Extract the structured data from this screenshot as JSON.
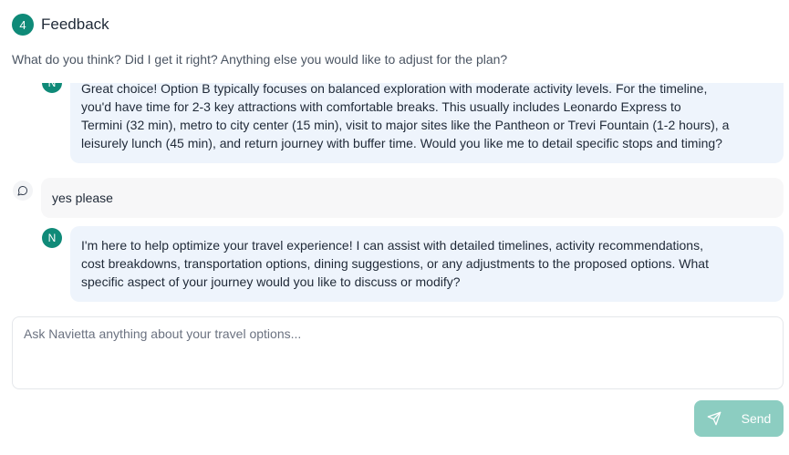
{
  "header": {
    "step_number": "4",
    "title": "Feedback"
  },
  "subtitle": "What do you think? Did I get it right? Anything else you would like to adjust for the plan?",
  "messages": [
    {
      "role": "assistant",
      "avatar": "N",
      "lines": [
        "Great choice! Option B typically focuses on balanced exploration with moderate activity levels. For the timeline,",
        "you'd have time for 2-3 key attractions with comfortable breaks. This usually includes Leonardo Express to",
        "Termini (32 min), metro to city center (15 min), visit to major sites like the Pantheon or Trevi Fountain (1-2 hours), a",
        "leisurely lunch (45 min), and return journey with buffer time. Would you like me to detail specific stops and timing?"
      ]
    },
    {
      "role": "user",
      "icon": "chat-bubble-icon",
      "text": "yes please"
    },
    {
      "role": "assistant",
      "avatar": "N",
      "lines": [
        "I'm here to help optimize your travel experience! I can assist with detailed timelines, activity recommendations,",
        "cost breakdowns, transportation options, dining suggestions, or any adjustments to the proposed options. What",
        "specific aspect of your journey would you like to discuss or modify?"
      ]
    }
  ],
  "composer": {
    "placeholder": "Ask Navietta anything about your travel options...",
    "value": "",
    "send_label": "Send"
  },
  "colors": {
    "brand": "#0f8a78",
    "send_button": "#8ccdc1",
    "assistant_bubble": "#eef4fc",
    "user_bubble": "#f7f7f8"
  }
}
